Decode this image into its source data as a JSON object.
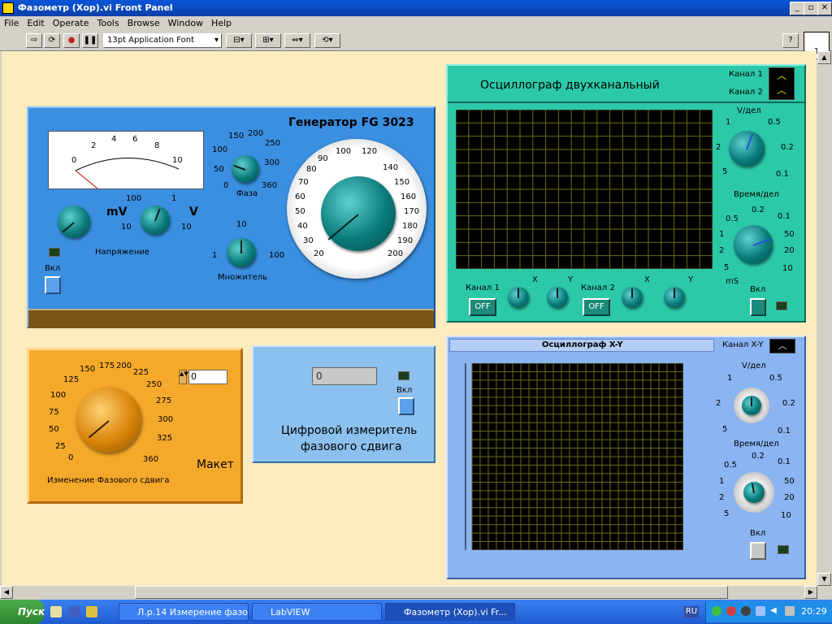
{
  "window": {
    "title": "Фазометр (Хор).vi Front Panel"
  },
  "menu": [
    "File",
    "Edit",
    "Operate",
    "Tools",
    "Browse",
    "Window",
    "Help"
  ],
  "toolbar": {
    "font_select": "13pt Application Font",
    "help": "?",
    "vi_counter": "1"
  },
  "generator": {
    "title": "Генератор FG 3023",
    "meter_scale": [
      "0",
      "2",
      "4",
      "6",
      "8",
      "10"
    ],
    "unit_mv": "mV",
    "unit_v": "V",
    "range_labels": [
      "100",
      "1",
      "10",
      "10"
    ],
    "voltage_label": "Напряжение",
    "on_label": "Вкл",
    "phase_scale": [
      "0",
      "50",
      "100",
      "150",
      "200",
      "250",
      "300",
      "360"
    ],
    "phase_label": "Фаза",
    "mult_scale": [
      "1",
      "10",
      "100"
    ],
    "mult_label": "Множитель",
    "freq_scale": [
      "20",
      "30",
      "40",
      "50",
      "60",
      "70",
      "80",
      "90",
      "100",
      "120",
      "140",
      "150",
      "160",
      "170",
      "180",
      "190",
      "200"
    ]
  },
  "maket": {
    "title": "Макет",
    "scale": [
      "0",
      "25",
      "50",
      "75",
      "100",
      "125",
      "150",
      "175",
      "200",
      "225",
      "250",
      "275",
      "300",
      "325",
      "360"
    ],
    "knob_label": "Изменение Фазового сдвига",
    "numeric_value": "0"
  },
  "digital_meter": {
    "display_value": "0",
    "on_label": "Вкл",
    "caption_line1": "Цифровой измеритель",
    "caption_line2": "фазового сдвига"
  },
  "osc2": {
    "title": "Осциллограф двухканальный",
    "ch1_label": "Канал 1",
    "ch2_label": "Канал 2",
    "volt_label": "V/дел",
    "volt_scale": [
      "1",
      "0.5",
      "2",
      "0.2",
      "5",
      "0.1"
    ],
    "time_label": "Время/дел",
    "time_scale": [
      "0.5",
      "0.2",
      "0.1",
      "1",
      "50",
      "2",
      "20",
      "5",
      "10"
    ],
    "ms_label": "mS",
    "on_label": "Вкл",
    "off_label": "OFF",
    "x_label": "X",
    "y_label": "Y"
  },
  "oscxy": {
    "title": "Осциллограф X-Y",
    "ch_label": "Канал X-Y",
    "volt_label": "V/дел",
    "volt_scale": [
      "1",
      "0.5",
      "2",
      "0.2",
      "5",
      "0.1"
    ],
    "time_label": "Время/дел",
    "time_scale": [
      "0.5",
      "0.2",
      "0.1",
      "1",
      "50",
      "2",
      "20",
      "5",
      "10"
    ],
    "on_label": "Вкл"
  },
  "taskbar": {
    "start": "Пуск",
    "tasks": [
      "Л.р.14 Измерение фазо...",
      "LabVIEW",
      "Фазометр (Хор).vi Fr..."
    ],
    "lang": "RU",
    "clock": "20:29"
  },
  "colors": {
    "canvas": "#fbebbe",
    "generator": "#3b8fe0",
    "maket": "#f5a92a",
    "digital": "#8cc0ee",
    "osc2": "#2cc9a8",
    "oscxy": "#8ab4f2",
    "screen": "#000000",
    "grid": "#6a6a16"
  }
}
